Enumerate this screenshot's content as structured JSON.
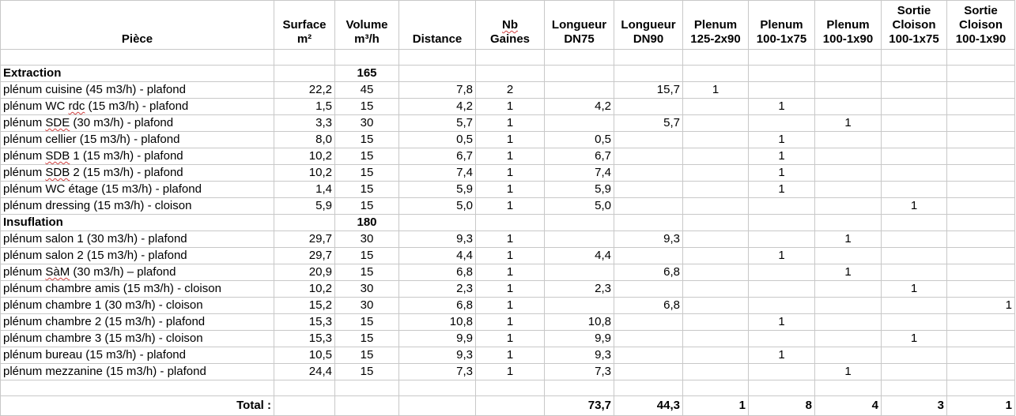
{
  "headers": {
    "piece": "Pièce",
    "surface": [
      "Surface",
      "m²"
    ],
    "volume": [
      "Volume",
      "m³/h"
    ],
    "distance": "Distance",
    "nb_gaines": [
      "Nb",
      "Gaines"
    ],
    "long_dn75": [
      "Longueur",
      "DN75"
    ],
    "long_dn90": [
      "Longueur",
      "DN90"
    ],
    "plenum_125": [
      "Plenum",
      "125-2x90"
    ],
    "plenum_100_75": [
      "Plenum",
      "100-1x75"
    ],
    "plenum_100_90": [
      "Plenum",
      "100-1x90"
    ],
    "sortie_75": [
      "Sortie",
      "Cloison",
      "100-1x75"
    ],
    "sortie_90": [
      "Sortie",
      "Cloison",
      "100-1x90"
    ]
  },
  "sections": [
    {
      "name": "Extraction",
      "volume": "165",
      "rows": [
        {
          "pre": "plénum cuisine (45 m3/h) - plafond",
          "surface": "22,2",
          "volume": "45",
          "distance": "7,8",
          "nb": "2",
          "dn75": "",
          "dn90": "15,7",
          "p125": "1",
          "p75": "",
          "p90": "",
          "s75": "",
          "s90": ""
        },
        {
          "pre": "plénum WC ",
          "wavy": "rdc",
          "post": " (15 m3/h) - plafond",
          "surface": "1,5",
          "volume": "15",
          "distance": "4,2",
          "nb": "1",
          "dn75": "4,2",
          "dn90": "",
          "p125": "",
          "p75": "1",
          "p90": "",
          "s75": "",
          "s90": ""
        },
        {
          "pre": "plénum ",
          "wavy": "SDE",
          "post": " (30 m3/h) - plafond",
          "surface": "3,3",
          "volume": "30",
          "distance": "5,7",
          "nb": "1",
          "dn75": "",
          "dn90": "5,7",
          "p125": "",
          "p75": "",
          "p90": "1",
          "s75": "",
          "s90": ""
        },
        {
          "pre": "plénum cellier (15 m3/h) - plafond",
          "surface": "8,0",
          "volume": "15",
          "distance": "0,5",
          "nb": "1",
          "dn75": "0,5",
          "dn90": "",
          "p125": "",
          "p75": "1",
          "p90": "",
          "s75": "",
          "s90": ""
        },
        {
          "pre": "plénum ",
          "wavy": "SDB",
          "post": " 1 (15 m3/h) - plafond",
          "surface": "10,2",
          "volume": "15",
          "distance": "6,7",
          "nb": "1",
          "dn75": "6,7",
          "dn90": "",
          "p125": "",
          "p75": "1",
          "p90": "",
          "s75": "",
          "s90": ""
        },
        {
          "pre": "plénum ",
          "wavy": "SDB",
          "post": " 2 (15 m3/h) - plafond",
          "surface": "10,2",
          "volume": "15",
          "distance": "7,4",
          "nb": "1",
          "dn75": "7,4",
          "dn90": "",
          "p125": "",
          "p75": "1",
          "p90": "",
          "s75": "",
          "s90": ""
        },
        {
          "pre": "plénum WC étage (15 m3/h) - plafond",
          "surface": "1,4",
          "volume": "15",
          "distance": "5,9",
          "nb": "1",
          "dn75": "5,9",
          "dn90": "",
          "p125": "",
          "p75": "1",
          "p90": "",
          "s75": "",
          "s90": ""
        },
        {
          "pre": "plénum dressing (15 m3/h) - cloison",
          "surface": "5,9",
          "volume": "15",
          "distance": "5,0",
          "nb": "1",
          "dn75": "5,0",
          "dn90": "",
          "p125": "",
          "p75": "",
          "p90": "",
          "s75": "1",
          "s90": ""
        }
      ]
    },
    {
      "name": "Insuflation",
      "volume": "180",
      "rows": [
        {
          "pre": "plénum salon 1 (30 m3/h) - plafond",
          "surface": "29,7",
          "volume": "30",
          "distance": "9,3",
          "nb": "1",
          "dn75": "",
          "dn90": "9,3",
          "p125": "",
          "p75": "",
          "p90": "1",
          "s75": "",
          "s90": ""
        },
        {
          "pre": "plénum salon 2 (15 m3/h) - plafond",
          "surface": "29,7",
          "volume": "15",
          "distance": "4,4",
          "nb": "1",
          "dn75": "4,4",
          "dn90": "",
          "p125": "",
          "p75": "1",
          "p90": "",
          "s75": "",
          "s90": ""
        },
        {
          "pre": "plénum ",
          "wavy": "SàM",
          "post": " (30 m3/h) – plafond",
          "surface": "20,9",
          "volume": "15",
          "distance": "6,8",
          "nb": "1",
          "dn75": "",
          "dn90": "6,8",
          "p125": "",
          "p75": "",
          "p90": "1",
          "s75": "",
          "s90": ""
        },
        {
          "pre": "plénum chambre amis (15 m3/h) - cloison",
          "surface": "10,2",
          "volume": "30",
          "distance": "2,3",
          "nb": "1",
          "dn75": "2,3",
          "dn90": "",
          "p125": "",
          "p75": "",
          "p90": "",
          "s75": "1",
          "s90": ""
        },
        {
          "pre": "plénum chambre 1 (30 m3/h) - cloison",
          "surface": "15,2",
          "volume": "30",
          "distance": "6,8",
          "nb": "1",
          "dn75": "",
          "dn90": "6,8",
          "p125": "",
          "p75": "",
          "p90": "",
          "s75": "",
          "s90": "1"
        },
        {
          "pre": "plénum chambre 2 (15 m3/h) - plafond",
          "surface": "15,3",
          "volume": "15",
          "distance": "10,8",
          "nb": "1",
          "dn75": "10,8",
          "dn90": "",
          "p125": "",
          "p75": "1",
          "p90": "",
          "s75": "",
          "s90": ""
        },
        {
          "pre": "plénum chambre 3 (15 m3/h) - cloison",
          "surface": "15,3",
          "volume": "15",
          "distance": "9,9",
          "nb": "1",
          "dn75": "9,9",
          "dn90": "",
          "p125": "",
          "p75": "",
          "p90": "",
          "s75": "1",
          "s90": ""
        },
        {
          "pre": "plénum bureau (15 m3/h) - plafond",
          "surface": "10,5",
          "volume": "15",
          "distance": "9,3",
          "nb": "1",
          "dn75": "9,3",
          "dn90": "",
          "p125": "",
          "p75": "1",
          "p90": "",
          "s75": "",
          "s90": ""
        },
        {
          "pre": "plénum mezzanine (15 m3/h) - plafond",
          "surface": "24,4",
          "volume": "15",
          "distance": "7,3",
          "nb": "1",
          "dn75": "7,3",
          "dn90": "",
          "p125": "",
          "p75": "",
          "p90": "1",
          "s75": "",
          "s90": ""
        }
      ]
    }
  ],
  "total": {
    "label": "Total :",
    "dn75": "73,7",
    "dn90": "44,3",
    "p125": "1",
    "p75": "8",
    "p90": "4",
    "s75": "3",
    "s90": "1"
  }
}
